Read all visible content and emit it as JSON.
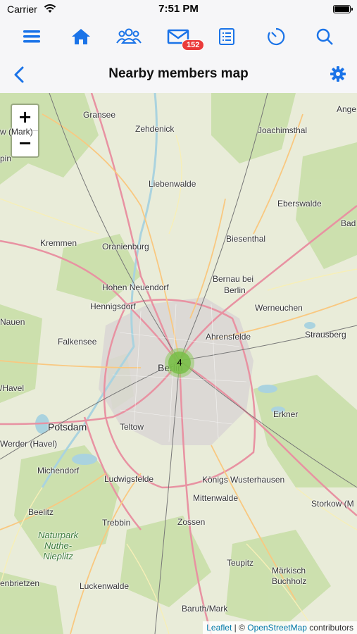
{
  "status_bar": {
    "carrier": "Carrier",
    "time": "7:51 PM"
  },
  "toolbar": {
    "items": [
      {
        "icon": "menu-icon"
      },
      {
        "icon": "home-icon"
      },
      {
        "icon": "members-icon"
      },
      {
        "icon": "mail-icon"
      },
      {
        "icon": "list-icon"
      },
      {
        "icon": "activity-clock-icon"
      },
      {
        "icon": "search-icon"
      }
    ],
    "mail_badge": "152"
  },
  "navbar": {
    "title": "Nearby members map"
  },
  "map": {
    "zoom_in": "+",
    "zoom_out": "−",
    "cluster_count": "4",
    "places": {
      "angermuende": "Ange",
      "gransee": "Gransee",
      "zehdenick": "Zehdenick",
      "joachimsthal": "Joachimsthal",
      "wmark": "w (Mark)",
      "pin": "pin",
      "liebenwalde": "Liebenwalde",
      "eberswalde": "Eberswalde",
      "bad": "Bad",
      "kremmen": "Kremmen",
      "oranienburg": "Oranienburg",
      "biesenthal": "Biesenthal",
      "bernau": "Bernau bei",
      "berlin_b": "Berlin",
      "hohen_neuendorf": "Hohen Neuendorf",
      "hennigsdorf": "Hennigsdorf",
      "werneuchen": "Werneuchen",
      "nauen": "Nauen",
      "ahrensfelde": "Ahrensfelde",
      "falkensee": "Falkensee",
      "strausberg": "Strausberg",
      "berlin": "Berlin",
      "havel": "/Havel",
      "erkner": "Erkner",
      "potsdam": "Potsdam",
      "teltow": "Teltow",
      "werder": "Werder (Havel)",
      "michendorf": "Michendorf",
      "ludwigsfelde": "Ludwigsfelde",
      "koenigs": "Königs Wusterhausen",
      "mittenwalde": "Mittenwalde",
      "storkow": "Storkow (M",
      "beelitz": "Beelitz",
      "trebbin": "Trebbin",
      "zossen": "Zossen",
      "naturpark": "Naturpark\nNuthe-\nNieplitz",
      "teupitz": "Teupitz",
      "maerkisch": "Märkisch\nBuchholz",
      "enbrietzen": "enbrietzen",
      "luckenwalde": "Luckenwalde",
      "baruth": "Baruth/Mark"
    },
    "attribution": {
      "leaflet": "Leaflet",
      "sep": " | © ",
      "osm": "OpenStreetMap",
      "contributors": " contributors"
    }
  }
}
